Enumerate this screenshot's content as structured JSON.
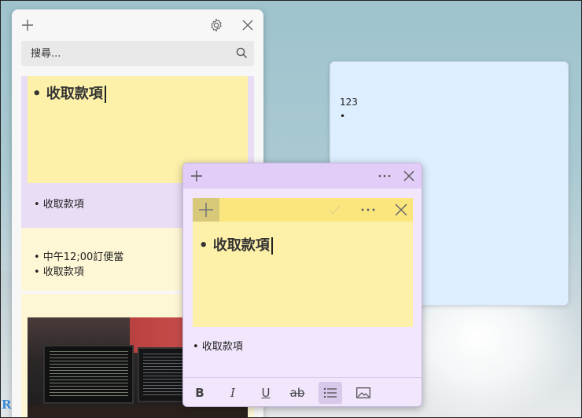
{
  "list_panel": {
    "search": {
      "placeholder": "搜尋..."
    },
    "notes": [
      {
        "big_text": "• 收取款項",
        "text": "• 收取款項",
        "color": "#e9dcf5"
      },
      {
        "lines": [
          "• 中午12;00訂便當",
          "• 收取款項"
        ],
        "color": "#fef7d6"
      },
      {
        "has_image": true,
        "color": "#fef7d6"
      }
    ]
  },
  "blue_note": {
    "lines": [
      "123",
      "•"
    ],
    "color": "#ddeefe"
  },
  "purple_note": {
    "embedded_text": "• 收取款項",
    "text": "• 收取款項",
    "format": {
      "bold": "B",
      "italic": "I",
      "underline": "U",
      "strike": "ab"
    },
    "color": "#f1e6fc"
  },
  "watermark": "R",
  "icons": [
    "plus-icon",
    "gear-icon",
    "close-icon",
    "search-icon",
    "more-icon",
    "check-icon",
    "list-icon",
    "image-icon"
  ]
}
